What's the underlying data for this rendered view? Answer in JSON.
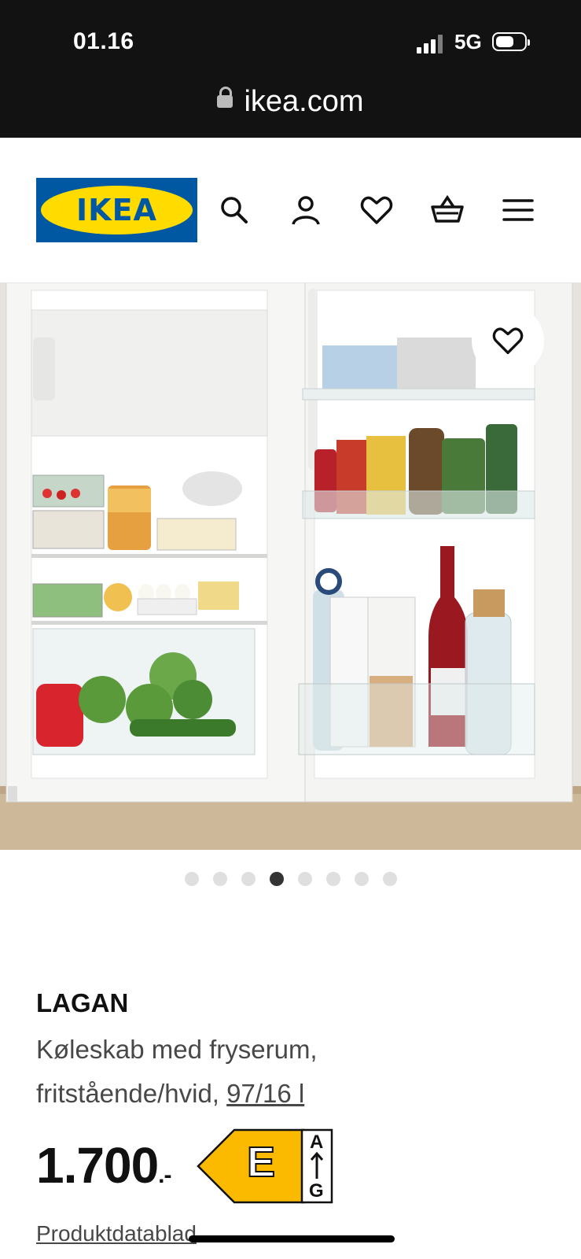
{
  "status": {
    "time": "01.16",
    "network": "5G"
  },
  "browser": {
    "url": "ikea.com"
  },
  "header": {
    "logo_text": "IKEA"
  },
  "gallery": {
    "total_images": 8,
    "active_index": 3
  },
  "product": {
    "name": "LAGAN",
    "description": "Køleskab med fryserum, fritstående/hvid,",
    "size_link": "97/16 l",
    "price": "1.700",
    "price_suffix": ".-",
    "energy_class": "E",
    "energy_scale_top": "A",
    "energy_scale_bottom": "G",
    "datasheet_link": "Produktdatablad"
  },
  "colors": {
    "ikea_blue": "#0058a3",
    "ikea_yellow": "#ffdb00",
    "energy_e": "#fbba00"
  }
}
